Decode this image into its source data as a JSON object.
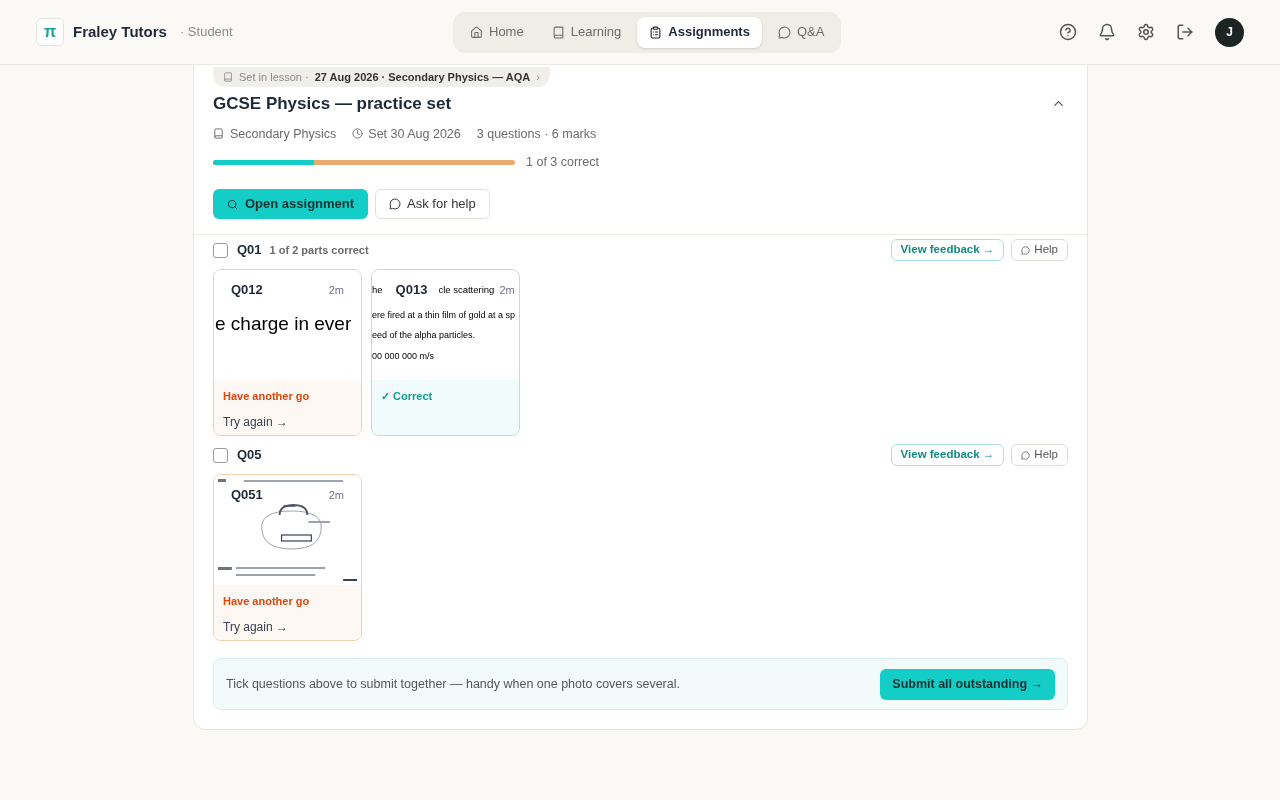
{
  "brand": {
    "logo": "π",
    "name": "Fraley Tutors",
    "role": "· Student"
  },
  "nav": [
    {
      "label": "Home",
      "selected": false
    },
    {
      "label": "Learning",
      "selected": false
    },
    {
      "label": "Assignments",
      "selected": true
    },
    {
      "label": "Q&A",
      "selected": false
    }
  ],
  "avatar": "J",
  "assignment": {
    "breadcrumb": {
      "prefix": "Set in lesson ·",
      "detail": "27 Aug 2026 · Secondary Physics — AQA",
      "arrow": "›"
    },
    "title": "GCSE Physics — practice set",
    "expanded": true,
    "subject": "Secondary Physics",
    "set_date": "Set 30 Aug 2026",
    "counts": "3 questions · 6 marks",
    "progress": {
      "level": 0.333,
      "reading": "1 of 3 correct"
    },
    "buttons": {
      "open": "Open assignment",
      "help": "Ask for help"
    }
  },
  "questions": [
    {
      "label": "Q01",
      "note": "1 of 2 parts correct",
      "checked": false,
      "feedback": "View feedback →",
      "help": "Help",
      "parts": [
        {
          "label": "Q012",
          "time": "2m",
          "kind": "big_text",
          "preview": [
            "e charge in ever"
          ],
          "correct": false,
          "status_text": "Have another go",
          "action": "Try again →"
        },
        {
          "label": "Q013",
          "time": "2m",
          "kind": "lines",
          "head": [
            "he",
            "cle scattering"
          ],
          "preview": [
            "ere fired at a thin film of gold at a sp",
            "eed of the alpha particles.",
            "00 000 000 m/s"
          ],
          "correct": true,
          "status_text": "✓ Correct"
        }
      ]
    },
    {
      "label": "Q05",
      "checked": false,
      "feedback": "View feedback →",
      "help": "Help",
      "parts": [
        {
          "label": "Q051",
          "time": "2m",
          "kind": "picture",
          "correct": false,
          "status_text": "Have another go",
          "action": "Try again →"
        }
      ]
    }
  ],
  "footer": {
    "text": "Tick questions above to submit together — handy when one photo covers several.",
    "button": "Submit all outstanding →"
  }
}
